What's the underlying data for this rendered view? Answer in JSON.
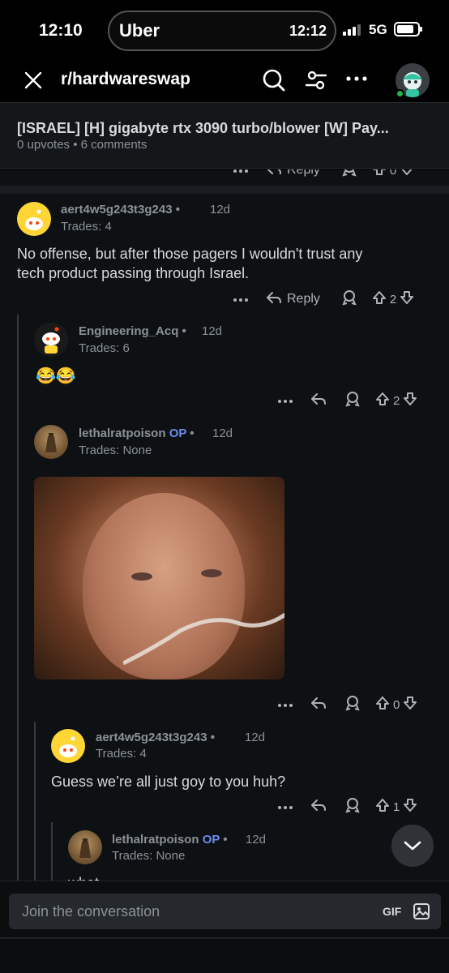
{
  "status_bar": {
    "time": "12:10",
    "network": "5G"
  },
  "dynamic_island": {
    "brand": "Uber",
    "time": "12:12"
  },
  "header": {
    "subreddit": "r/hardwareswap"
  },
  "post": {
    "title": "[ISRAEL] [H] gigabyte rtx 3090 turbo/blower [W] Pay...",
    "meta": "0 upvotes • 6 comments"
  },
  "partial_action": {
    "reply_label": "Reply",
    "votes": "0"
  },
  "comments": [
    {
      "username": "aert4w5g243t3g243",
      "age": "12d",
      "trades": "Trades: 4",
      "body_line1": "No offense, but after those pagers I wouldn't trust any",
      "body_line2": "tech product passing through Israel.",
      "reply_label": "Reply",
      "votes": "2"
    },
    {
      "username": "Engineering_Acq",
      "age": "12d",
      "trades": "Trades: 6",
      "body": "😂😂",
      "votes": "2"
    },
    {
      "username": "lethalratpoison",
      "op": "OP",
      "age": "12d",
      "trades": "Trades: None",
      "votes": "0"
    },
    {
      "username": "aert4w5g243t3g243",
      "age": "12d",
      "trades": "Trades: 4",
      "body": "Guess we’re all just goy to you huh?",
      "votes": "1"
    },
    {
      "username": "lethalratpoison",
      "op": "OP",
      "age": "12d",
      "trades": "Trades: None",
      "body_partial": "what"
    }
  ],
  "composer": {
    "placeholder": "Join the conversation",
    "gif_label": "GIF"
  },
  "colors": {
    "background": "#0e1113",
    "op_badge": "#6c8cf0",
    "avatar_yellow": "#ffd635",
    "online": "#28b34a"
  }
}
